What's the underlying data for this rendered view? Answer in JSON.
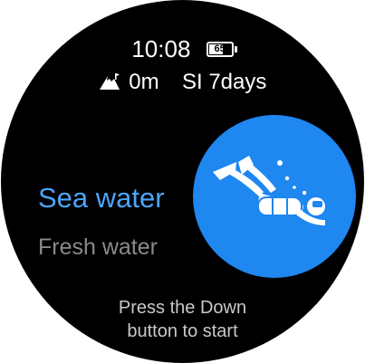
{
  "status_bar": {
    "time": "10:08",
    "battery_level": "65"
  },
  "dive_info": {
    "altitude_icon": "mountain-altitude-icon",
    "altitude": "0m",
    "surface_interval": "SI 7days"
  },
  "water_modes": {
    "items": [
      {
        "label": "Sea water",
        "selected": true
      },
      {
        "label": "Fresh water",
        "selected": false
      }
    ]
  },
  "dive_icon": "scuba-diver-icon",
  "hint": {
    "line1": "Press the Down",
    "line2": "button to start"
  },
  "colors": {
    "background": "#000000",
    "selected_text": "#4aa5ff",
    "unselected_text": "#8a8a8a",
    "icon_circle": "#1e87f0",
    "hint_text": "#c8c8c8"
  }
}
